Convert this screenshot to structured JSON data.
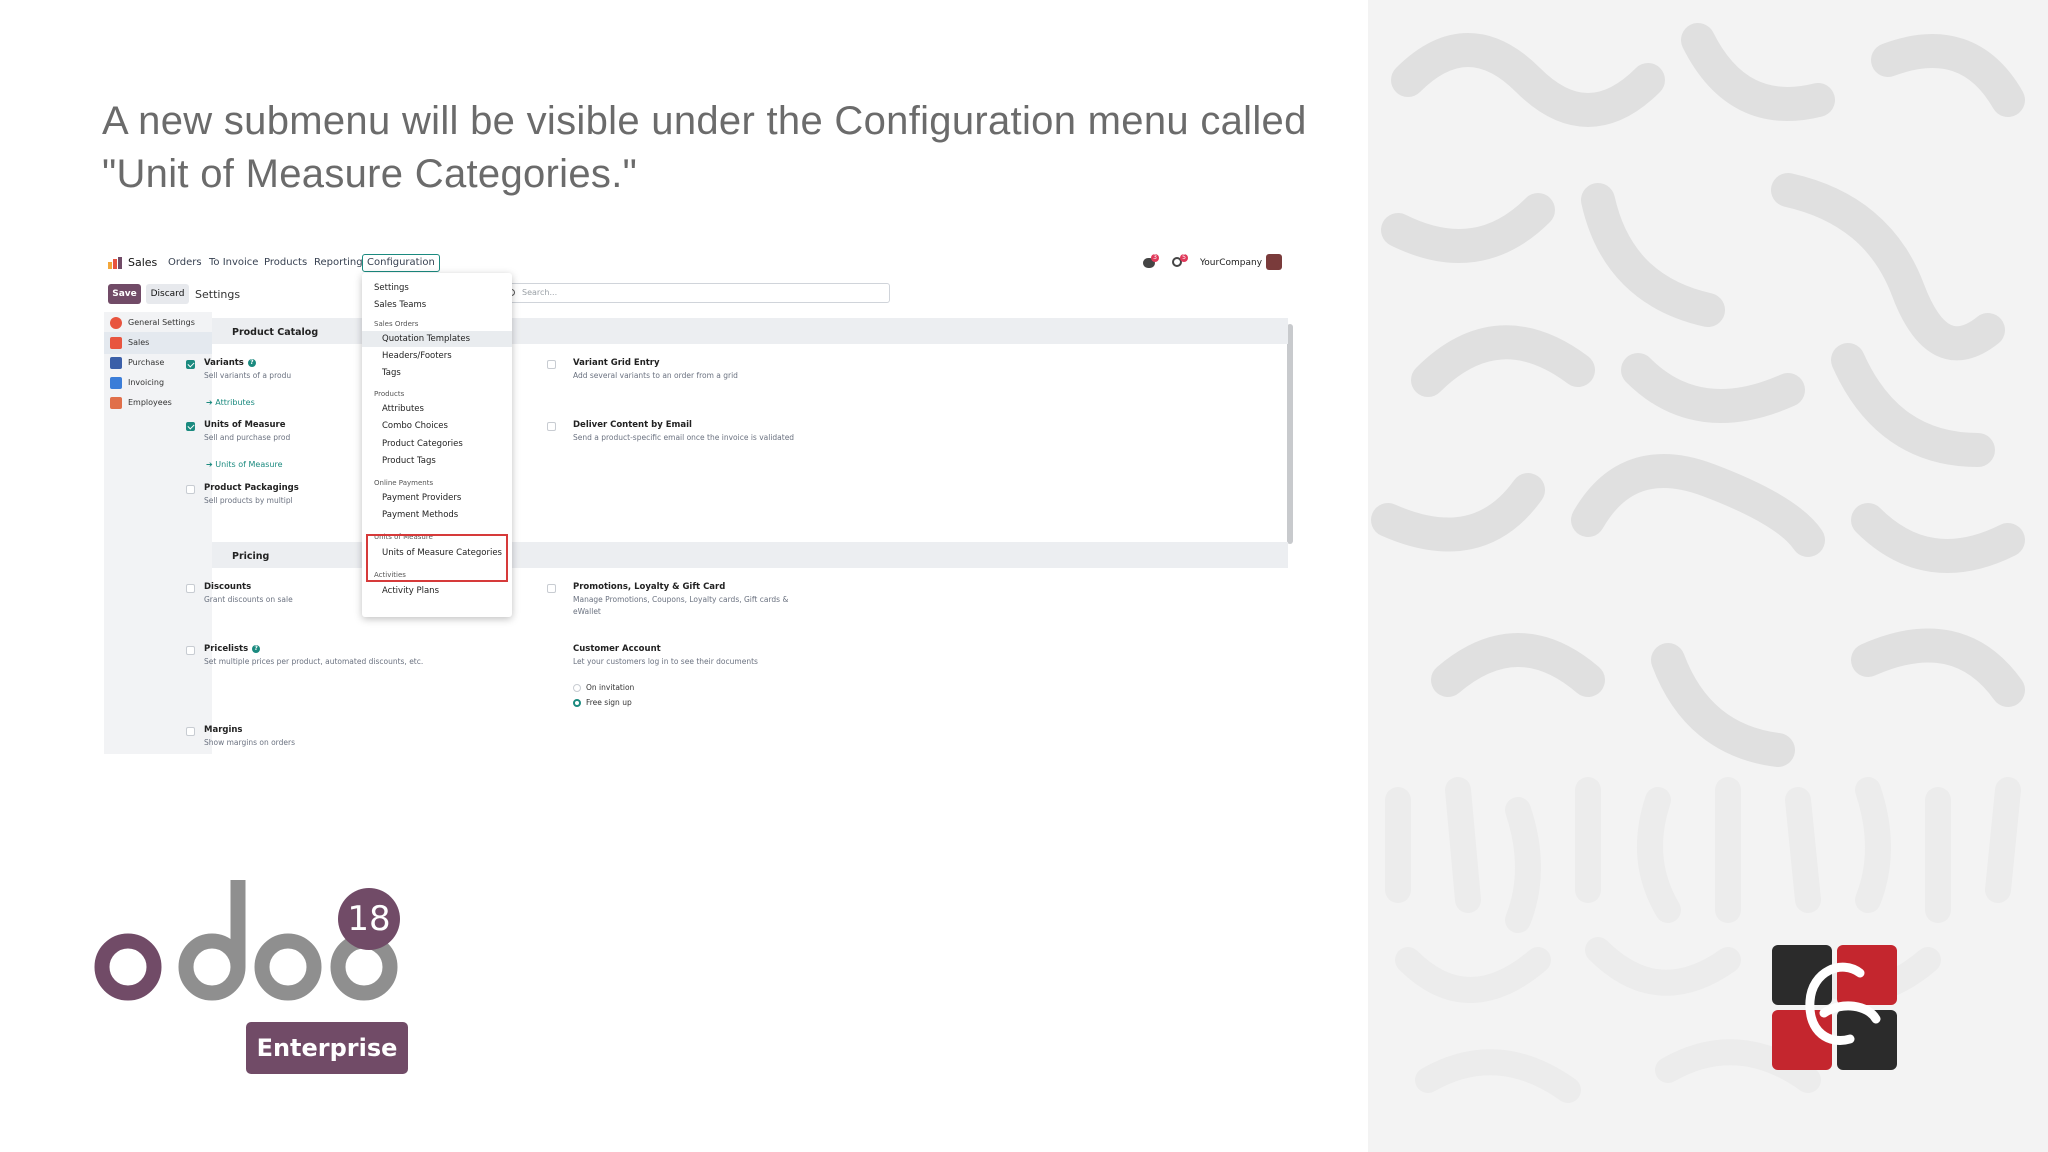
{
  "slide": {
    "text": "A new submenu will be visible under the Configuration menu called \"Unit of Measure Categories.\""
  },
  "topbar": {
    "app_name": "Sales",
    "menus": [
      "Orders",
      "To Invoice",
      "Products",
      "Reporting"
    ],
    "configuration": "Configuration",
    "company": "YourCompany",
    "chat_badge": "3",
    "activity_badge": "5"
  },
  "controls": {
    "save": "Save",
    "discard": "Discard",
    "breadcrumb": "Settings",
    "search_placeholder": "Search..."
  },
  "sidebar": {
    "items": [
      {
        "label": "General Settings",
        "icon": "gear-icon",
        "color": "#e8543f"
      },
      {
        "label": "Sales",
        "icon": "sales-icon",
        "color": "#e8543f"
      },
      {
        "label": "Purchase",
        "icon": "purchase-icon",
        "color": "#3b5fa8"
      },
      {
        "label": "Invoicing",
        "icon": "invoice-icon",
        "color": "#3b7dd8"
      },
      {
        "label": "Employees",
        "icon": "employees-icon",
        "color": "#e06f4a"
      }
    ]
  },
  "dropdown": {
    "settings": "Settings",
    "sales_teams": "Sales Teams",
    "group_sales_orders": "Sales Orders",
    "quotation_templates": "Quotation Templates",
    "headers_footers": "Headers/Footers",
    "tags": "Tags",
    "group_products": "Products",
    "attributes": "Attributes",
    "combo_choices": "Combo Choices",
    "product_categories": "Product Categories",
    "product_tags": "Product Tags",
    "group_online_payments": "Online Payments",
    "payment_providers": "Payment Providers",
    "payment_methods": "Payment Methods",
    "group_uom": "Units of Measure",
    "uom_categories": "Units of Measure Categories",
    "group_activities": "Activities",
    "activity_plans": "Activity Plans"
  },
  "sections": {
    "product_catalog": "Product Catalog",
    "pricing": "Pricing"
  },
  "settings": {
    "variants": {
      "title": "Variants",
      "desc": "Sell variants of a produ",
      "link": "Attributes",
      "checked": true
    },
    "uom": {
      "title": "Units of Measure",
      "desc": "Sell and purchase prod",
      "link": "Units of Measure",
      "checked": true
    },
    "packagings": {
      "title": "Product Packagings",
      "desc": "Sell products by multipl",
      "checked": false
    },
    "variant_grid": {
      "title": "Variant Grid Entry",
      "desc": "Add several variants to an order from a grid",
      "checked": false
    },
    "deliver_email": {
      "title": "Deliver Content by Email",
      "desc": "Send a product-specific email once the invoice is validated",
      "checked": false
    },
    "discounts": {
      "title": "Discounts",
      "desc": "Grant discounts on sale",
      "checked": false
    },
    "pricelists": {
      "title": "Pricelists",
      "desc": "Set multiple prices per product, automated discounts, etc.",
      "checked": false
    },
    "margins": {
      "title": "Margins",
      "desc": "Show margins on orders",
      "checked": false
    },
    "promotions": {
      "title": "Promotions, Loyalty & Gift Card",
      "desc1": "Manage Promotions, Coupons, Loyalty cards, Gift cards &",
      "desc2": "eWallet",
      "checked": false
    },
    "customer_account": {
      "title": "Customer Account",
      "desc": "Let your customers log in to see their documents",
      "opt1": "On invitation",
      "opt2": "Free sign up",
      "selected": "Free sign up"
    }
  },
  "logos": {
    "odoo_text": "odoo",
    "version": "18",
    "edition": "Enterprise",
    "odoo_color": "#714b67",
    "brand_colors": [
      "#2b2b2b",
      "#c4262e"
    ]
  }
}
